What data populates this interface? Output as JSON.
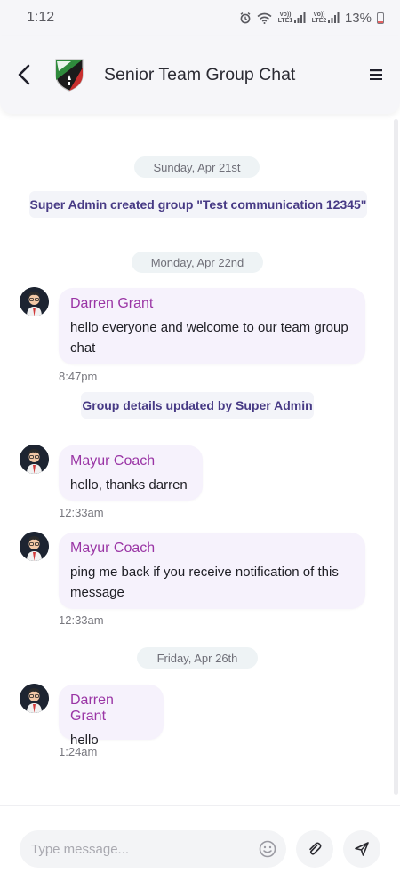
{
  "status_bar": {
    "time": "1:12",
    "battery": "13%",
    "icons": [
      "alarm-icon",
      "wifi-icon",
      "volte-lte1-signal-icon",
      "volte-lte2-signal-icon",
      "battery-icon"
    ],
    "lte1": "Vo)) LTE1",
    "lte2": "Vo)) LTE2"
  },
  "header": {
    "title": "Senior Team Group Chat",
    "back_icon": "back-arrow-icon",
    "logo_icon": "team-shield-logo",
    "menu_icon": "hamburger-menu-icon"
  },
  "chat": {
    "dates": [
      "Sunday, Apr 21st",
      "Monday, Apr 22nd",
      "Friday, Apr 26th"
    ],
    "system_messages": [
      "Super Admin created group \"Test communication 12345\"",
      "Group details updated by Super Admin"
    ],
    "messages": [
      {
        "sender": "Darren Grant",
        "text": "hello everyone and welcome to our team group chat",
        "time": "8:47pm"
      },
      {
        "sender": "Mayur Coach",
        "text": "hello, thanks darren",
        "time": "12:33am"
      },
      {
        "sender": "Mayur Coach",
        "text": "ping me back if you receive notification of this message",
        "time": "12:33am"
      },
      {
        "sender": "Darren Grant",
        "text": "hello",
        "time": "1:24am"
      }
    ]
  },
  "composer": {
    "placeholder": "Type message...",
    "emoji_icon": "emoji-smile-icon",
    "attach_icon": "paperclip-icon",
    "send_icon": "send-icon"
  },
  "colors": {
    "sender_name": "#9a35a5",
    "system_text": "#473a85",
    "bubble_bg": "#f6f2fc",
    "header_bg": "#f6f6f9"
  }
}
